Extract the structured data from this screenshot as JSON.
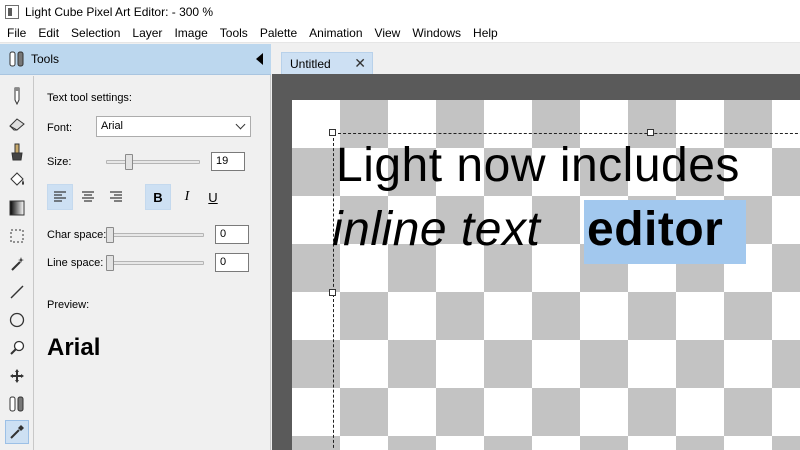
{
  "window": {
    "title": "Light Cube Pixel Art Editor:  - 300 %"
  },
  "menu": [
    "File",
    "Edit",
    "Selection",
    "Layer",
    "Image",
    "Tools",
    "Palette",
    "Animation",
    "View",
    "Windows",
    "Help"
  ],
  "tools_panel": {
    "title": "Tools",
    "tool_icons": [
      "pencil-icon",
      "eraser-icon",
      "brush-icon",
      "fill-bucket-icon",
      "gradient-icon",
      "rect-select-icon",
      "magic-wand-icon",
      "line-icon",
      "ellipse-icon",
      "zoom-icon",
      "move-icon",
      "clone-icon",
      "eyedropper-icon"
    ],
    "active_tool": "eyedropper-icon"
  },
  "text_settings": {
    "heading": "Text tool settings:",
    "font_label": "Font:",
    "font_value": "Arial",
    "size_label": "Size:",
    "size_value": "19",
    "char_space_label": "Char space:",
    "char_space_value": "0",
    "line_space_label": "Line space:",
    "line_space_value": "0",
    "preview_label": "Preview:",
    "preview_text": "Arial",
    "bold_active": true,
    "italic_active": false,
    "underline_active": false,
    "align": "left",
    "format_labels": {
      "bold": "B",
      "italic": "I",
      "underline": "U"
    }
  },
  "document": {
    "tab_label": "Untitled",
    "tab_close": "✕",
    "text_line1": "Light now includes",
    "text_line2_regular": "inline text",
    "text_line2_selected": "editor"
  }
}
